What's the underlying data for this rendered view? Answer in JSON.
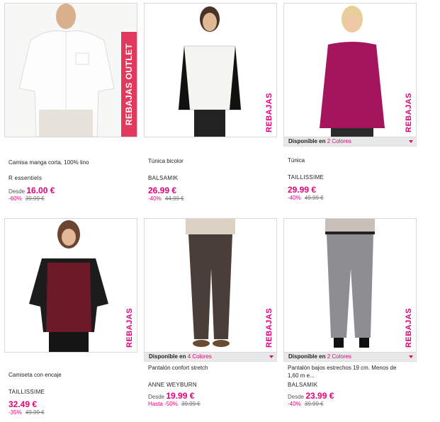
{
  "products": [
    {
      "tag": "REBAJAS OUTLET",
      "title": "Camisa manga corta, 100% lino",
      "brand": "R essentiels",
      "price_prefix": "Desde",
      "price": "16.00 €",
      "discount": "-60%",
      "old_price": "39.99 €",
      "image": "white-linen-shirt"
    },
    {
      "tag": "REBAJAS",
      "title": "Túnica bicolor",
      "brand": "BALSAMIK",
      "price_prefix": "",
      "price": "26.99 €",
      "discount": "-40%",
      "old_price": "44.99 €",
      "image": "bicolor-tunic"
    },
    {
      "tag": "REBAJAS",
      "colors_label": "Disponible en",
      "colors_link": "2 Colores",
      "title": "Túnica",
      "brand": "TAILLISSIME",
      "price_prefix": "",
      "price": "29.99 €",
      "discount": "-40%",
      "old_price": "49.99 €",
      "image": "magenta-tunic"
    },
    {
      "tag": "REBAJAS",
      "title": "Camiseta con encaje",
      "brand": "TAILLISSIME",
      "price_prefix": "",
      "price": "32.49 €",
      "discount": "-35%",
      "old_price": "49.99 €",
      "image": "lace-tshirt"
    },
    {
      "tag": "REBAJAS",
      "colors_label": "Disponible en",
      "colors_link": "4 Colores",
      "title": "Pantalón confort stretch",
      "brand": "ANNE WEYBURN",
      "price_prefix": "Desde",
      "price": "19.99 €",
      "discount": "Hasta -50%",
      "old_price": "39.99 €",
      "image": "brown-trousers"
    },
    {
      "tag": "REBAJAS",
      "colors_label": "Disponible en",
      "colors_link": "2 Colores",
      "title": "Pantalón bajos estrechos 19 cm. Menos de 1,60 m e...",
      "brand": "BALSAMIK",
      "price_prefix": "Desde",
      "price": "23.99 €",
      "discount": "-40%",
      "old_price": "39.99 €",
      "image": "grey-trousers"
    }
  ],
  "colors": {
    "accent": "#e6007e",
    "outlet_tag": "#e23a5c"
  }
}
